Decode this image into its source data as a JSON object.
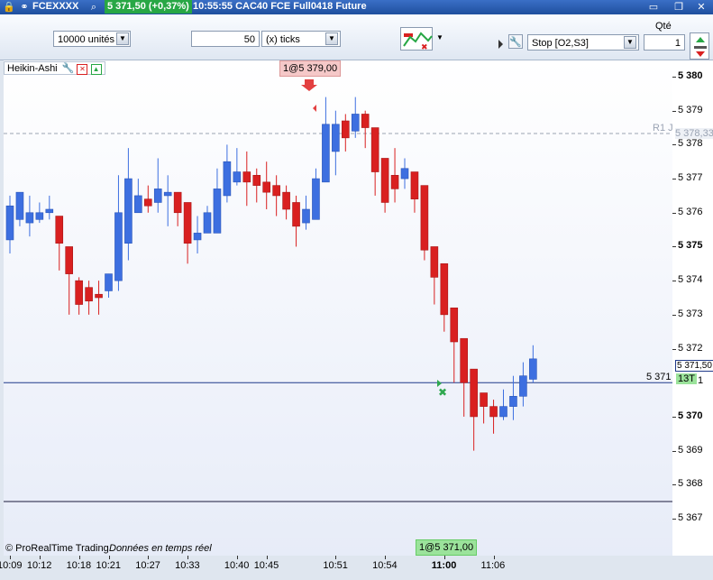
{
  "titlebar": {
    "symbol": "FCEXXXX",
    "price_change": "5 371,50 (+0,37%)",
    "description": "10:55:55  CAC40 FCE Full0418 Future"
  },
  "toolbar": {
    "quantity_units": "10000 unités",
    "ticks_value": "50",
    "ticks_unit": "(x) ticks",
    "qty_label": "Qté",
    "order_type": "Stop [O2,S3]",
    "qty_value": "1"
  },
  "indicator": {
    "name": "Heikin-Ashi"
  },
  "orders": {
    "sell_order": "1@5 379,00",
    "buy_order": "1@5 371,00"
  },
  "levels": {
    "r1_label": "R1 J",
    "r1_value": "5 378,33",
    "current_price": "5 371,50",
    "position_price": "5 371",
    "position_tag": "13T",
    "position_qty": "1"
  },
  "footer": {
    "copyright": "© ProRealTime Trading",
    "data_note": "Données en temps réel"
  },
  "price_axis": [
    {
      "label": "5 380",
      "value": 5380,
      "bold": true
    },
    {
      "label": "5 379",
      "value": 5379,
      "bold": false
    },
    {
      "label": "5 378",
      "value": 5378,
      "bold": false
    },
    {
      "label": "5 377",
      "value": 5377,
      "bold": false
    },
    {
      "label": "5 376",
      "value": 5376,
      "bold": false
    },
    {
      "label": "5 375",
      "value": 5375,
      "bold": true
    },
    {
      "label": "5 374",
      "value": 5374,
      "bold": false
    },
    {
      "label": "5 373",
      "value": 5373,
      "bold": false
    },
    {
      "label": "5 372",
      "value": 5372,
      "bold": false
    },
    {
      "label": "5 370",
      "value": 5370,
      "bold": true
    },
    {
      "label": "5 369",
      "value": 5369,
      "bold": false
    },
    {
      "label": "5 368",
      "value": 5368,
      "bold": false
    },
    {
      "label": "5 367",
      "value": 5367,
      "bold": false
    }
  ],
  "time_axis": [
    {
      "label": "10:09",
      "index": 0,
      "bold": false
    },
    {
      "label": "10:12",
      "index": 3,
      "bold": false
    },
    {
      "label": "10:18",
      "index": 7,
      "bold": false
    },
    {
      "label": "10:21",
      "index": 10,
      "bold": false
    },
    {
      "label": "10:27",
      "index": 14,
      "bold": false
    },
    {
      "label": "10:33",
      "index": 18,
      "bold": false
    },
    {
      "label": "10:40",
      "index": 23,
      "bold": false
    },
    {
      "label": "10:45",
      "index": 26,
      "bold": false
    },
    {
      "label": "10:51",
      "index": 33,
      "bold": false
    },
    {
      "label": "10:54",
      "index": 38,
      "bold": false
    },
    {
      "label": "11:00",
      "index": 44,
      "bold": true
    },
    {
      "label": "11:06",
      "index": 49,
      "bold": false
    }
  ],
  "chart_data": {
    "type": "candlestick",
    "y_range": [
      5366.5,
      5380.6
    ],
    "colors": {
      "up": "#3d6fe0",
      "down": "#d92020"
    },
    "candles": [
      {
        "o": 5375.2,
        "c": 5376.2,
        "h": 5376.5,
        "l": 5374.8
      },
      {
        "o": 5375.8,
        "c": 5376.6,
        "h": 5376.6,
        "l": 5375.6
      },
      {
        "o": 5375.7,
        "c": 5376.0,
        "h": 5376.5,
        "l": 5375.3
      },
      {
        "o": 5375.8,
        "c": 5376.0,
        "h": 5376.3,
        "l": 5375.7
      },
      {
        "o": 5376.0,
        "c": 5376.1,
        "h": 5376.5,
        "l": 5375.8
      },
      {
        "o": 5375.9,
        "c": 5375.1,
        "h": 5375.9,
        "l": 5374.3
      },
      {
        "o": 5375.0,
        "c": 5374.2,
        "h": 5375.0,
        "l": 5373.0
      },
      {
        "o": 5374.0,
        "c": 5373.3,
        "h": 5374.1,
        "l": 5373.0
      },
      {
        "o": 5373.8,
        "c": 5373.4,
        "h": 5374.0,
        "l": 5373.0
      },
      {
        "o": 5373.6,
        "c": 5373.5,
        "h": 5374.0,
        "l": 5373.0
      },
      {
        "o": 5373.7,
        "c": 5374.2,
        "h": 5374.2,
        "l": 5373.5
      },
      {
        "o": 5374.0,
        "c": 5376.0,
        "h": 5377.1,
        "l": 5373.7
      },
      {
        "o": 5375.1,
        "c": 5377.0,
        "h": 5377.9,
        "l": 5374.6
      },
      {
        "o": 5376.0,
        "c": 5376.5,
        "h": 5377.0,
        "l": 5376.0
      },
      {
        "o": 5376.4,
        "c": 5376.2,
        "h": 5376.8,
        "l": 5376.0
      },
      {
        "o": 5376.3,
        "c": 5376.7,
        "h": 5377.6,
        "l": 5376.0
      },
      {
        "o": 5376.5,
        "c": 5376.6,
        "h": 5377.1,
        "l": 5375.6
      },
      {
        "o": 5376.6,
        "c": 5376.0,
        "h": 5376.6,
        "l": 5375.6
      },
      {
        "o": 5376.3,
        "c": 5375.1,
        "h": 5376.3,
        "l": 5374.5
      },
      {
        "o": 5375.2,
        "c": 5375.4,
        "h": 5375.9,
        "l": 5374.8
      },
      {
        "o": 5375.4,
        "c": 5376.0,
        "h": 5376.2,
        "l": 5375.4
      },
      {
        "o": 5375.4,
        "c": 5376.7,
        "h": 5377.3,
        "l": 5375.4
      },
      {
        "o": 5376.5,
        "c": 5377.5,
        "h": 5378.0,
        "l": 5376.3
      },
      {
        "o": 5376.9,
        "c": 5377.2,
        "h": 5377.9,
        "l": 5376.8
      },
      {
        "o": 5377.2,
        "c": 5376.9,
        "h": 5377.8,
        "l": 5376.2
      },
      {
        "o": 5377.1,
        "c": 5376.8,
        "h": 5377.3,
        "l": 5376.3
      },
      {
        "o": 5376.9,
        "c": 5376.6,
        "h": 5377.5,
        "l": 5376.1
      },
      {
        "o": 5376.8,
        "c": 5376.5,
        "h": 5377.1,
        "l": 5375.9
      },
      {
        "o": 5376.6,
        "c": 5376.1,
        "h": 5376.8,
        "l": 5375.8
      },
      {
        "o": 5376.3,
        "c": 5375.6,
        "h": 5376.5,
        "l": 5375.0
      },
      {
        "o": 5375.7,
        "c": 5376.1,
        "h": 5376.5,
        "l": 5375.5
      },
      {
        "o": 5375.8,
        "c": 5377.0,
        "h": 5377.3,
        "l": 5375.8
      },
      {
        "o": 5376.9,
        "c": 5378.6,
        "h": 5379.4,
        "l": 5376.9
      },
      {
        "o": 5377.8,
        "c": 5378.6,
        "h": 5379.0,
        "l": 5377.1
      },
      {
        "o": 5378.7,
        "c": 5378.2,
        "h": 5378.9,
        "l": 5377.8
      },
      {
        "o": 5378.4,
        "c": 5378.9,
        "h": 5379.4,
        "l": 5378.2
      },
      {
        "o": 5378.9,
        "c": 5378.5,
        "h": 5379.0,
        "l": 5377.9
      },
      {
        "o": 5378.5,
        "c": 5377.2,
        "h": 5378.5,
        "l": 5376.5
      },
      {
        "o": 5377.6,
        "c": 5376.3,
        "h": 5377.6,
        "l": 5376.0
      },
      {
        "o": 5377.1,
        "c": 5376.7,
        "h": 5377.9,
        "l": 5376.3
      },
      {
        "o": 5377.0,
        "c": 5377.3,
        "h": 5377.6,
        "l": 5376.7
      },
      {
        "o": 5377.2,
        "c": 5376.4,
        "h": 5377.2,
        "l": 5376.0
      },
      {
        "o": 5376.8,
        "c": 5374.9,
        "h": 5376.8,
        "l": 5374.6
      },
      {
        "o": 5375.0,
        "c": 5374.1,
        "h": 5375.0,
        "l": 5373.3
      },
      {
        "o": 5374.5,
        "c": 5373.0,
        "h": 5374.5,
        "l": 5372.5
      },
      {
        "o": 5373.2,
        "c": 5372.2,
        "h": 5373.2,
        "l": 5371.0
      },
      {
        "o": 5372.3,
        "c": 5371.0,
        "h": 5372.3,
        "l": 5370.0
      },
      {
        "o": 5371.4,
        "c": 5370.0,
        "h": 5371.4,
        "l": 5369.0
      },
      {
        "o": 5370.7,
        "c": 5370.3,
        "h": 5370.7,
        "l": 5369.8
      },
      {
        "o": 5370.3,
        "c": 5370.0,
        "h": 5370.5,
        "l": 5369.5
      },
      {
        "o": 5370.0,
        "c": 5370.3,
        "h": 5370.8,
        "l": 5369.9
      },
      {
        "o": 5370.3,
        "c": 5370.6,
        "h": 5371.2,
        "l": 5369.9
      },
      {
        "o": 5370.6,
        "c": 5371.2,
        "h": 5371.6,
        "l": 5370.3
      },
      {
        "o": 5371.1,
        "c": 5371.7,
        "h": 5372.1,
        "l": 5371.0
      }
    ]
  }
}
